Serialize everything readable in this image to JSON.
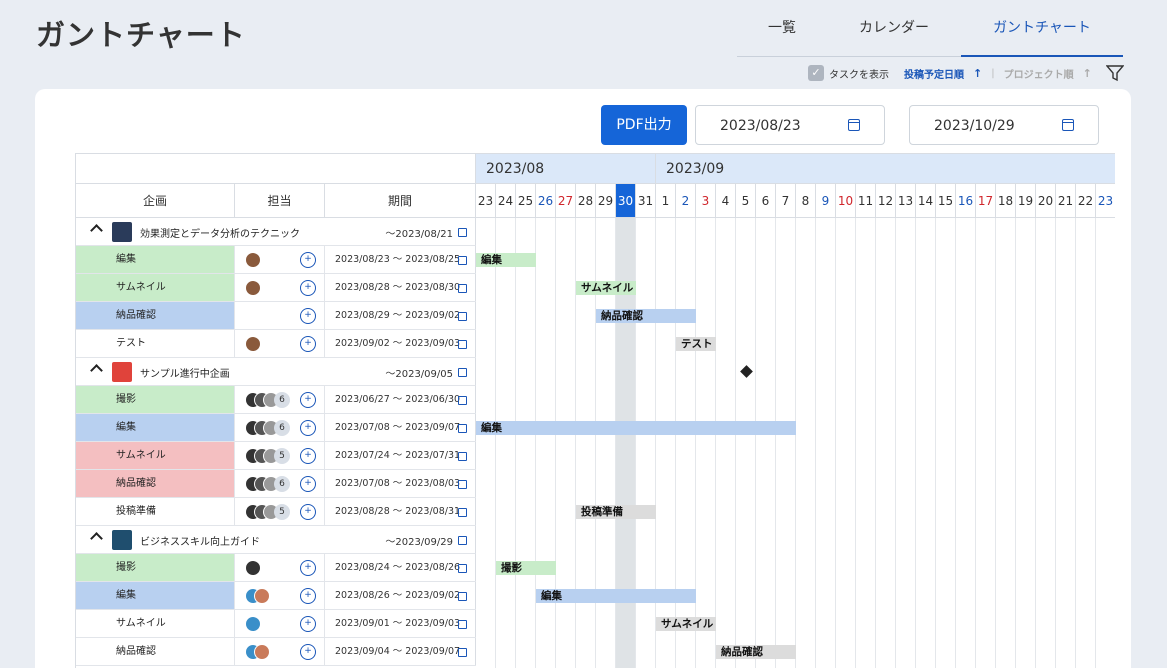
{
  "page": {
    "title": "ガントチャート"
  },
  "tabs": [
    {
      "label": "一覧",
      "active": false
    },
    {
      "label": "カレンダー",
      "active": false
    },
    {
      "label": "ガントチャート",
      "active": true
    }
  ],
  "toolbar": {
    "show_tasks_label": "タスクを表示",
    "show_tasks_checked": true,
    "sort_schedule_label": "投稿予定日順",
    "sort_project_label": "プロジェクト順",
    "sort_arrow": "↑",
    "separator": "|"
  },
  "controls": {
    "pdf_label": "PDF出力",
    "start_date": "2023/08/23",
    "end_date": "2023/10/29"
  },
  "columns": {
    "project": "企画",
    "assignee": "担当",
    "period": "期間"
  },
  "months": [
    "2023/08",
    "2023/09"
  ],
  "days": [
    {
      "d": "23",
      "t": ""
    },
    {
      "d": "24",
      "t": ""
    },
    {
      "d": "25",
      "t": ""
    },
    {
      "d": "26",
      "t": "sat"
    },
    {
      "d": "27",
      "t": "sun"
    },
    {
      "d": "28",
      "t": ""
    },
    {
      "d": "29",
      "t": ""
    },
    {
      "d": "30",
      "t": "today"
    },
    {
      "d": "31",
      "t": ""
    },
    {
      "d": "1",
      "t": ""
    },
    {
      "d": "2",
      "t": "sat"
    },
    {
      "d": "3",
      "t": "sun"
    },
    {
      "d": "4",
      "t": ""
    },
    {
      "d": "5",
      "t": ""
    },
    {
      "d": "6",
      "t": ""
    },
    {
      "d": "7",
      "t": ""
    },
    {
      "d": "8",
      "t": ""
    },
    {
      "d": "9",
      "t": "sat"
    },
    {
      "d": "10",
      "t": "sun"
    },
    {
      "d": "11",
      "t": ""
    },
    {
      "d": "12",
      "t": ""
    },
    {
      "d": "13",
      "t": ""
    },
    {
      "d": "14",
      "t": ""
    },
    {
      "d": "15",
      "t": ""
    },
    {
      "d": "16",
      "t": "sat"
    },
    {
      "d": "17",
      "t": "sun"
    },
    {
      "d": "18",
      "t": ""
    },
    {
      "d": "19",
      "t": ""
    },
    {
      "d": "20",
      "t": ""
    },
    {
      "d": "21",
      "t": ""
    },
    {
      "d": "22",
      "t": ""
    },
    {
      "d": "23",
      "t": "sat"
    }
  ],
  "colors": {
    "green": "#c8ecc9",
    "blue": "#b8d0f0",
    "red": "#f4bfc1",
    "gray": "#dcdcdc",
    "today": "#1565d8"
  },
  "rows": [
    {
      "kind": "project",
      "title": "効果測定とデータ分析のテクニック",
      "period": "〜2023/08/21",
      "thumb": "#2a3b5a"
    },
    {
      "kind": "task",
      "name": "編集",
      "color": "green",
      "avatars": [
        "#8a5a3c"
      ],
      "count": "",
      "period": "2023/08/23 〜 2023/08/25",
      "bar": {
        "label": "編集",
        "start": 0,
        "span": 3,
        "color": "green"
      }
    },
    {
      "kind": "task",
      "name": "サムネイル",
      "color": "green",
      "avatars": [
        "#8a5a3c"
      ],
      "count": "",
      "period": "2023/08/28 〜 2023/08/30",
      "bar": {
        "label": "サムネイル",
        "start": 5,
        "span": 3,
        "color": "green"
      }
    },
    {
      "kind": "task",
      "name": "納品確認",
      "color": "blue",
      "avatars": [],
      "count": "",
      "period": "2023/08/29 〜 2023/09/02",
      "bar": {
        "label": "納品確認",
        "start": 6,
        "span": 5,
        "color": "blue"
      }
    },
    {
      "kind": "task",
      "name": "テスト",
      "color": "",
      "avatars": [
        "#8a5a3c"
      ],
      "count": "",
      "period": "2023/09/02 〜 2023/09/03",
      "bar": {
        "label": "テスト",
        "start": 10,
        "span": 2,
        "color": "gray"
      }
    },
    {
      "kind": "project",
      "title": "サンプル進行中企画",
      "period": "〜2023/09/05",
      "thumb": "#e0433b",
      "milestone": 13
    },
    {
      "kind": "task",
      "name": "撮影",
      "color": "green",
      "avatars": [
        "#333",
        "#555",
        "#999"
      ],
      "count": "6",
      "period": "2023/06/27 〜 2023/06/30",
      "bar": null
    },
    {
      "kind": "task",
      "name": "編集",
      "color": "blue",
      "avatars": [
        "#333",
        "#555",
        "#999"
      ],
      "count": "6",
      "period": "2023/07/08 〜 2023/09/07",
      "bar": {
        "label": "編集",
        "start": 0,
        "span": 16,
        "color": "blue"
      }
    },
    {
      "kind": "task",
      "name": "サムネイル",
      "color": "red",
      "avatars": [
        "#333",
        "#555",
        "#999"
      ],
      "count": "5",
      "period": "2023/07/24 〜 2023/07/31",
      "bar": null
    },
    {
      "kind": "task",
      "name": "納品確認",
      "color": "red",
      "avatars": [
        "#333",
        "#555",
        "#999"
      ],
      "count": "6",
      "period": "2023/07/08 〜 2023/08/03",
      "bar": null
    },
    {
      "kind": "task",
      "name": "投稿準備",
      "color": "",
      "avatars": [
        "#333",
        "#555",
        "#999"
      ],
      "count": "5",
      "period": "2023/08/28 〜 2023/08/31",
      "bar": {
        "label": "投稿準備",
        "start": 5,
        "span": 4,
        "color": "gray"
      }
    },
    {
      "kind": "project",
      "title": "ビジネススキル向上ガイド",
      "period": "〜2023/09/29",
      "thumb": "#1f4e6e"
    },
    {
      "kind": "task",
      "name": "撮影",
      "color": "green",
      "avatars": [
        "#333"
      ],
      "count": "",
      "period": "2023/08/24 〜 2023/08/26",
      "bar": {
        "label": "撮影",
        "start": 1,
        "span": 3,
        "color": "green"
      }
    },
    {
      "kind": "task",
      "name": "編集",
      "color": "blue",
      "avatars": [
        "#3a8fc9",
        "#c97a5a"
      ],
      "count": "",
      "period": "2023/08/26 〜 2023/09/02",
      "bar": {
        "label": "編集",
        "start": 3,
        "span": 8,
        "color": "blue"
      }
    },
    {
      "kind": "task",
      "name": "サムネイル",
      "color": "",
      "avatars": [
        "#3a8fc9"
      ],
      "count": "",
      "period": "2023/09/01 〜 2023/09/03",
      "bar": {
        "label": "サムネイル",
        "start": 9,
        "span": 3,
        "color": "gray"
      }
    },
    {
      "kind": "task",
      "name": "納品確認",
      "color": "",
      "avatars": [
        "#3a8fc9",
        "#c97a5a"
      ],
      "count": "",
      "period": "2023/09/04 〜 2023/09/07",
      "bar": {
        "label": "納品確認",
        "start": 12,
        "span": 4,
        "color": "gray"
      }
    }
  ]
}
